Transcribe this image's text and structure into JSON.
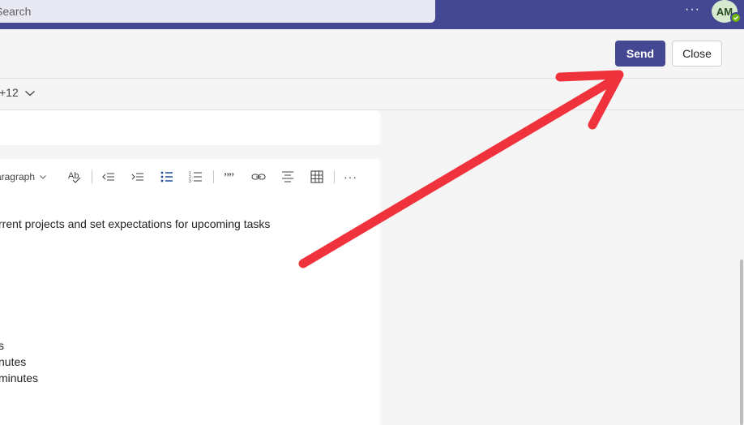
{
  "search": {
    "placeholder": "Search"
  },
  "topbar": {
    "more_label": "···",
    "avatar_initials": "AM",
    "accent": "#444791"
  },
  "header": {
    "send_label": "Send",
    "close_label": "Close"
  },
  "attendees": {
    "count_label": "+12"
  },
  "toolbar": {
    "paragraph_label": "Paragraph",
    "icons": [
      "spellcheck-icon",
      "decrease-indent-icon",
      "increase-indent-icon",
      "bulleted-list-icon",
      "numbered-list-icon",
      "quote-icon",
      "link-icon",
      "align-icon",
      "table-icon",
      "more-options-icon"
    ],
    "more_label": "···"
  },
  "editor": {
    "line1": "rrent projects and set expectations for upcoming tasks",
    "line2": "s",
    "line3": "nutes",
    "line4": "minutes"
  },
  "colors": {
    "brand": "#444791",
    "annotation": "#f0323c",
    "presence": "#6bb700"
  }
}
